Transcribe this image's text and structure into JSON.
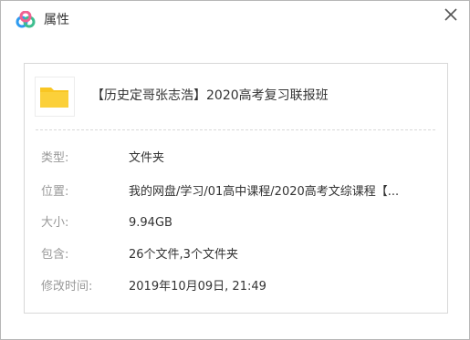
{
  "dialog": {
    "title": "属性",
    "logo_icon": "baidu-netdisk-cloud-icon",
    "close_icon": "close-icon"
  },
  "file": {
    "icon": "folder-icon",
    "name": "【历史定哥张志浩】2020高考复习联报班"
  },
  "properties": [
    {
      "label": "类型:",
      "value": "文件夹"
    },
    {
      "label": "位置:",
      "value": "我的网盘/学习/01高中课程/2020高考文综课程【..."
    },
    {
      "label": "大小:",
      "value": "9.94GB"
    },
    {
      "label": "包含:",
      "value": "26个文件,3个文件夹"
    },
    {
      "label": "修改时间:",
      "value": "2019年10月09日, 21:49"
    }
  ],
  "colors": {
    "folder": "#F9C623",
    "logo_blue": "#2E9BF0",
    "logo_pink": "#F06292",
    "logo_green": "#3DBE8F"
  }
}
